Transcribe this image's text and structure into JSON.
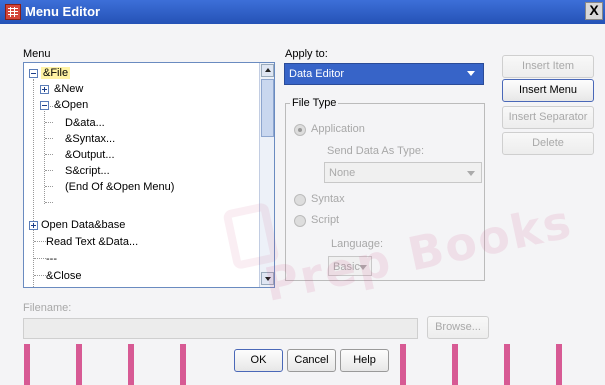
{
  "window": {
    "title": "Menu Editor",
    "close_glyph": "X"
  },
  "menu": {
    "label": "Menu",
    "tree": [
      {
        "label": "&File",
        "expander": "minus",
        "selected": true
      },
      {
        "label": "&New",
        "expander": "plus"
      },
      {
        "label": "&Open",
        "expander": "minus"
      },
      {
        "label": "D&ata..."
      },
      {
        "label": "&Syntax..."
      },
      {
        "label": "&Output..."
      },
      {
        "label": "S&cript..."
      },
      {
        "label": "(End Of &Open Menu)"
      },
      {
        "label": "Open Data&base",
        "expander": "plus"
      },
      {
        "label": "Read Text &Data..."
      },
      {
        "label": "---"
      },
      {
        "label": "&Close"
      }
    ]
  },
  "apply_to": {
    "label": "Apply to:",
    "value": "Data Editor"
  },
  "file_type": {
    "label": "File Type",
    "application": "Application",
    "send_data_as_type": "Send Data As Type:",
    "send_data_value": "None",
    "syntax": "Syntax",
    "script": "Script",
    "language_label": "Language:",
    "language_value": "Basic"
  },
  "buttons": {
    "insert_item": "Insert Item",
    "insert_menu": "Insert Menu",
    "insert_separator": "Insert Separator",
    "delete": "Delete",
    "browse": "Browse...",
    "ok": "OK",
    "cancel": "Cancel",
    "help": "Help"
  },
  "filename": {
    "label": "Filename:",
    "value": ""
  },
  "watermark": {
    "text": "Prep Books"
  },
  "colors": {
    "combo_bg": "#3764c8",
    "selection": "#fff3a4",
    "stripe": "#d75a94",
    "titlebar": "#2f5fc8"
  }
}
